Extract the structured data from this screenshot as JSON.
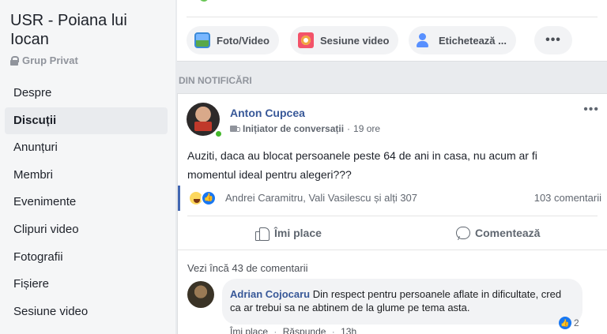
{
  "sidebar": {
    "group_name": "USR - Poiana lui Iocan",
    "privacy": "Grup Privat",
    "items": [
      {
        "label": "Despre"
      },
      {
        "label": "Discuții"
      },
      {
        "label": "Anunțuri"
      },
      {
        "label": "Membri"
      },
      {
        "label": "Evenimente"
      },
      {
        "label": "Clipuri video"
      },
      {
        "label": "Fotografii"
      },
      {
        "label": "Fișiere"
      },
      {
        "label": "Sesiune video"
      }
    ],
    "active_item": "Discuții"
  },
  "composer": {
    "buttons": [
      {
        "label": "Foto/Video",
        "icon": "photo-video-icon"
      },
      {
        "label": "Sesiune video",
        "icon": "live-video-icon"
      },
      {
        "label": "Etichetează ...",
        "icon": "tag-people-icon"
      }
    ],
    "more_label": "•••"
  },
  "section_label": "DIN NOTIFICĂRI",
  "post": {
    "author": "Anton Cupcea",
    "badge": "Inițiator de conversații",
    "separator": "·",
    "time": "19 ore",
    "more": "•••",
    "text_line1": "Auziti, daca au blocat persoanele peste 64 de ani in casa, nu acum ar fi",
    "text_line2": "momentul ideal pentru alegeri???",
    "reactions": {
      "names": "Andrei Caramitru, Vali Vasilescu și alți 307",
      "comments_count": "103 comentarii",
      "icons": [
        "haha-icon",
        "like-icon"
      ]
    },
    "actions": {
      "like": "Îmi place",
      "comment": "Comentează"
    },
    "more_comments": "Vezi încă 43 de comentarii",
    "comment": {
      "author": "Adrian Cojocaru",
      "text": "Din respect pentru persoanele aflate in dificultate, cred ca ar trebui sa ne abtinem de la glume pe tema asta.",
      "like_count": "2",
      "like_action": "Îmi place",
      "reply_action": "Răspunde",
      "time": "13h"
    }
  },
  "colors": {
    "link_blue": "#385898",
    "sidebar_bg": "#f5f6f7",
    "page_bg": "#e9ebee",
    "online_green": "#42b72a",
    "reaction_blue": "#1877f2"
  }
}
